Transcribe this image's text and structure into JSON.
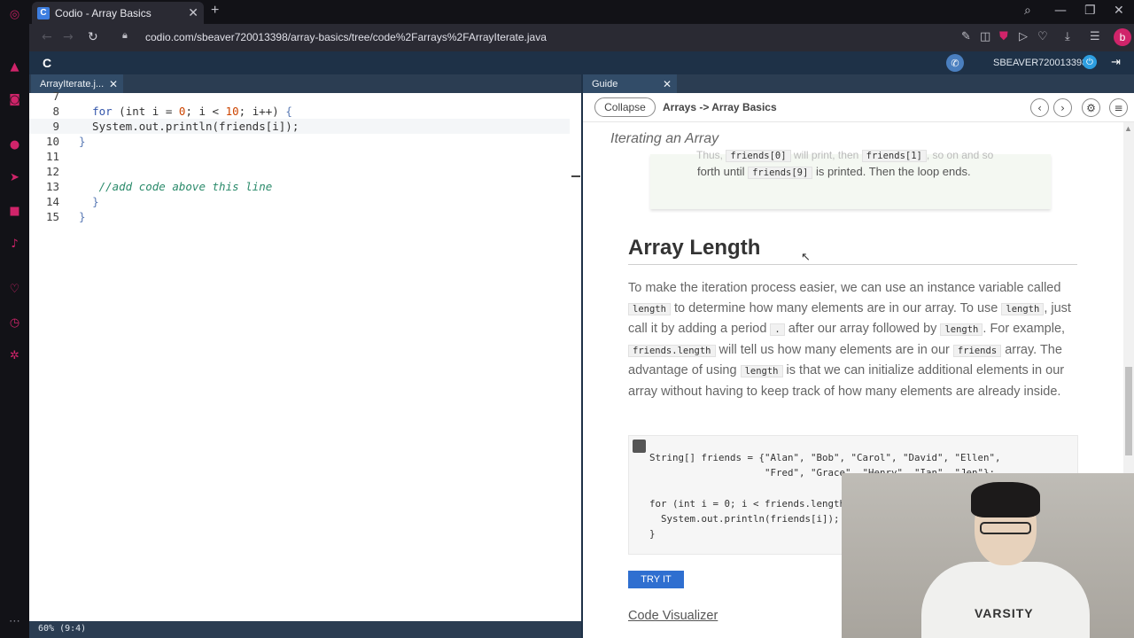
{
  "browser": {
    "tab_title": "Codio - Array Basics",
    "tab_favicon": "C",
    "url": "codio.com/sbeaver720013398/array-basics/tree/code%2Farrays%2FArrayIterate.java",
    "profile_initial": "b"
  },
  "codio": {
    "logo": "C",
    "username": "SBEAVER720013398"
  },
  "editor": {
    "tab_label": "ArrayIterate.j...",
    "status": "60% (9:4)",
    "line_numbers": [
      "7",
      "8",
      "9",
      "10",
      "11",
      "12",
      "13",
      "14",
      "15"
    ]
  },
  "guide": {
    "tab_label": "Guide",
    "collapse_label": "Collapse",
    "breadcrumb": "Arrays -> Array Basics",
    "section_heading": "Iterating an Array",
    "prev_card": {
      "line1_a": "Thus,",
      "line1_code1": "friends[0]",
      "line1_b": "will print, then",
      "line1_code2": "friends[1]",
      "line1_c": ", so on and so",
      "line2_a": "forth until",
      "line2_code": "friends[9]",
      "line2_b": "is printed. Then the loop ends."
    },
    "heading": "Array Length",
    "para": {
      "t1": "To make the iteration process easier, we can use an instance variable called",
      "c1": "length",
      "t2": "to determine how many elements are in our array. To use",
      "c2": "length",
      "t3": ", just call it by adding a period",
      "c3": ".",
      "t4": "after our array followed by",
      "c4": "length",
      "t5": ". For example,",
      "c5": "friends.length",
      "t6": "will tell us how many elements are in our",
      "c6": "friends",
      "t7": "array. The advantage of using",
      "c7": "length",
      "t8": "is that we can initialize additional elements in our array without having to keep track of how many elements are already inside."
    },
    "code_lines": [
      "String[] friends = {\"Alan\", \"Bob\", \"Carol\", \"David\", \"Ellen\",",
      "                    \"Fred\", \"Grace\", \"Henry\", \"Ian\", \"Jen\"};",
      "",
      "for (int i = 0; i < friends.length",
      "  System.out.println(friends[i]);",
      "}"
    ],
    "try_it": "TRY IT",
    "visualizer": "Code Visualizer"
  },
  "webcam": {
    "shirt_text": "VARSITY"
  }
}
